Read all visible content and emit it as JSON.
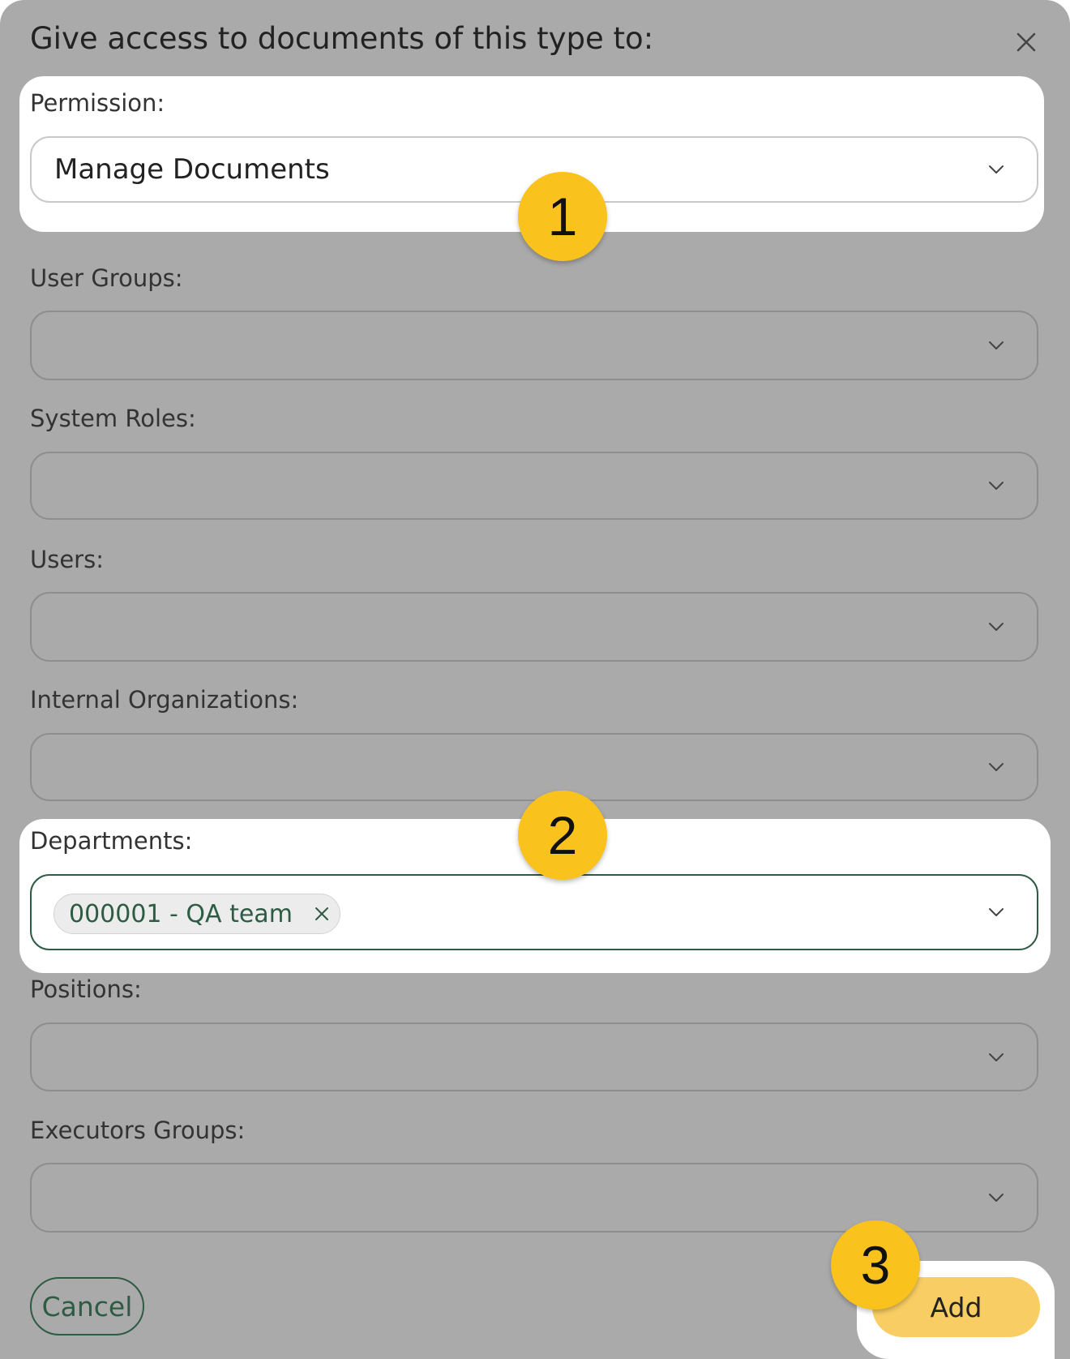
{
  "dialog": {
    "title": "Give access to documents of this type to:"
  },
  "fields": {
    "permission": {
      "label": "Permission:",
      "value": "Manage Documents"
    },
    "user_groups": {
      "label": "User Groups:"
    },
    "system_roles": {
      "label": "System Roles:"
    },
    "users": {
      "label": "Users:"
    },
    "internal_organizations": {
      "label": "Internal Organizations:"
    },
    "departments": {
      "label": "Departments:",
      "chips": [
        "000001 - QA team"
      ]
    },
    "positions": {
      "label": "Positions:"
    },
    "executors_groups": {
      "label": "Executors Groups:"
    }
  },
  "buttons": {
    "cancel": "Cancel",
    "add": "Add"
  },
  "badges": [
    "1",
    "2",
    "3"
  ],
  "colors": {
    "overlay": "#aaaaaa",
    "accent_green": "#2e5b44",
    "badge_yellow": "#f9c21c",
    "add_button": "#f8cd63"
  },
  "icons": {
    "close": "close-icon",
    "dropdown": "chevron-down-icon",
    "chip_remove": "close-icon"
  }
}
